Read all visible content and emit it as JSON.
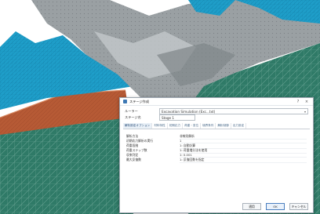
{
  "dialog": {
    "title": "ステージ作成",
    "controls": {
      "help": "?",
      "close": "×"
    },
    "fields": [
      {
        "label": "ルーラー",
        "value": "Excavation Simulation (Exc...txt)"
      },
      {
        "label": "ステージ名",
        "value": "Stage 1"
      }
    ],
    "tabs": [
      "解析設定オプション",
      "材料特性",
      "初期応力",
      "荷重・変位",
      "境界条件",
      "解析制御",
      "出力設定"
    ],
    "properties": [
      {
        "key": "解析方法",
        "value": "非線形解析"
      },
      {
        "key": "初期応力解析の実行",
        "value": "1"
      },
      {
        "key": "荷重段階",
        "value": "1: 自動計算"
      },
      {
        "key": "荷重ステップ数",
        "value": "1: 荷重増分法を使用"
      },
      {
        "key": "収束判定",
        "value": "1: 0.001"
      },
      {
        "key": "最大反復数",
        "value": "1: 反復回数を指定"
      }
    ],
    "buttons": {
      "ok": "適用",
      "apply": "OK",
      "cancel": "キャンセル"
    }
  },
  "colors": {
    "teal_mesh": "#2f7a67",
    "blue_mesh": "#1e9ec9",
    "rock_gray": "#9aa0a3",
    "orange_soil": "#b65a35",
    "dialog_border": "#9aa4ae"
  }
}
